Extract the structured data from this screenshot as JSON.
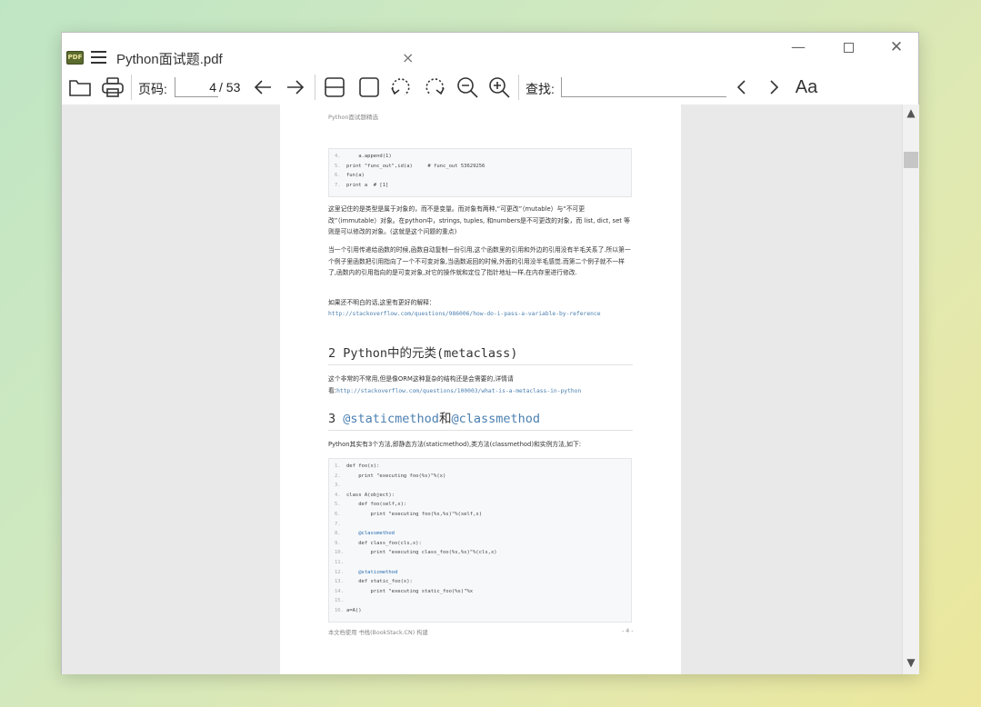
{
  "window": {
    "tab_title": "Python面试题.pdf",
    "logo_text": "PDF",
    "close_tab": "×",
    "min": "—",
    "close": "✕"
  },
  "toolbar": {
    "page_label": "页码:",
    "page_current": "4",
    "page_total": "/ 53",
    "search_label": "查找:",
    "search_value": "",
    "font_label": "Aa"
  },
  "document": {
    "running_head": "Python面试题精选",
    "code1": [
      {
        "n": "4.",
        "t": "    a.append(1)"
      },
      {
        "n": "5.",
        "t": "print \"func_out\",id(a)     # func_out 53629256"
      },
      {
        "n": "6.",
        "t": "fun(a)"
      },
      {
        "n": "7.",
        "t": "print a  # [1]"
      }
    ],
    "para1": "这里记住的是类型是属于对象的，而不是变量。而对象有两种,“可更改”（mutable）与“不可更改”（immutable）对象。在python中，strings, tuples, 和numbers是不可更改的对象，而 list, dict, set 等则是可以修改的对象。(这就是这个问题的重点)",
    "para2": "当一个引用传递给函数的时候,函数自动复制一份引用,这个函数里的引用和外边的引用没有半毛关系了.所以第一个例子里函数把引用指向了一个不可变对象,当函数返回的时候,外面的引用没半毛感觉.而第二个例子就不一样了,函数内的引用指向的是可变对象,对它的操作就和定位了指针地址一样,在内存里进行修改.",
    "para3": "如果还不明白的话,这里有更好的解释：",
    "link1": "http://stackoverflow.com/questions/986006/how-do-i-pass-a-variable-by-reference",
    "h2_1": "2 Python中的元类(metaclass)",
    "para4": "这个非常的不常用,但是像ORM这种复杂的结构还是会需要的,详情请看:",
    "link2": "http://stackoverflow.com/questions/100003/what-is-a-metaclass-in-python",
    "h2_2_num": "3 ",
    "h2_2_a": "@staticmethod",
    "h2_2_mid": "和",
    "h2_2_b": "@classmethod",
    "para5": "Python其实有3个方法,即静态方法(staticmethod),类方法(classmethod)和实例方法,如下:",
    "code2": [
      {
        "n": "1.",
        "t": "def foo(x):"
      },
      {
        "n": "2.",
        "t": "    print \"executing foo(%s)\"%(x)"
      },
      {
        "n": "3.",
        "t": ""
      },
      {
        "n": "4.",
        "t": "class A(object):"
      },
      {
        "n": "5.",
        "t": "    def foo(self,x):"
      },
      {
        "n": "6.",
        "t": "        print \"executing foo(%s,%s)\"%(self,x)"
      },
      {
        "n": "7.",
        "t": ""
      },
      {
        "n": "8.",
        "t": "    @classmethod"
      },
      {
        "n": "9.",
        "t": "    def class_foo(cls,x):"
      },
      {
        "n": "10.",
        "t": "        print \"executing class_foo(%s,%s)\"%(cls,x)"
      },
      {
        "n": "11.",
        "t": ""
      },
      {
        "n": "12.",
        "t": "    @staticmethod"
      },
      {
        "n": "13.",
        "t": "    def static_foo(x):"
      },
      {
        "n": "14.",
        "t": "        print \"executing static_foo(%s)\"%x"
      },
      {
        "n": "15.",
        "t": ""
      },
      {
        "n": "16.",
        "t": "a=A()"
      }
    ],
    "footer_left": "本文档使用 书栈(BookStack.CN) 构建",
    "footer_right": "- 4 -"
  }
}
